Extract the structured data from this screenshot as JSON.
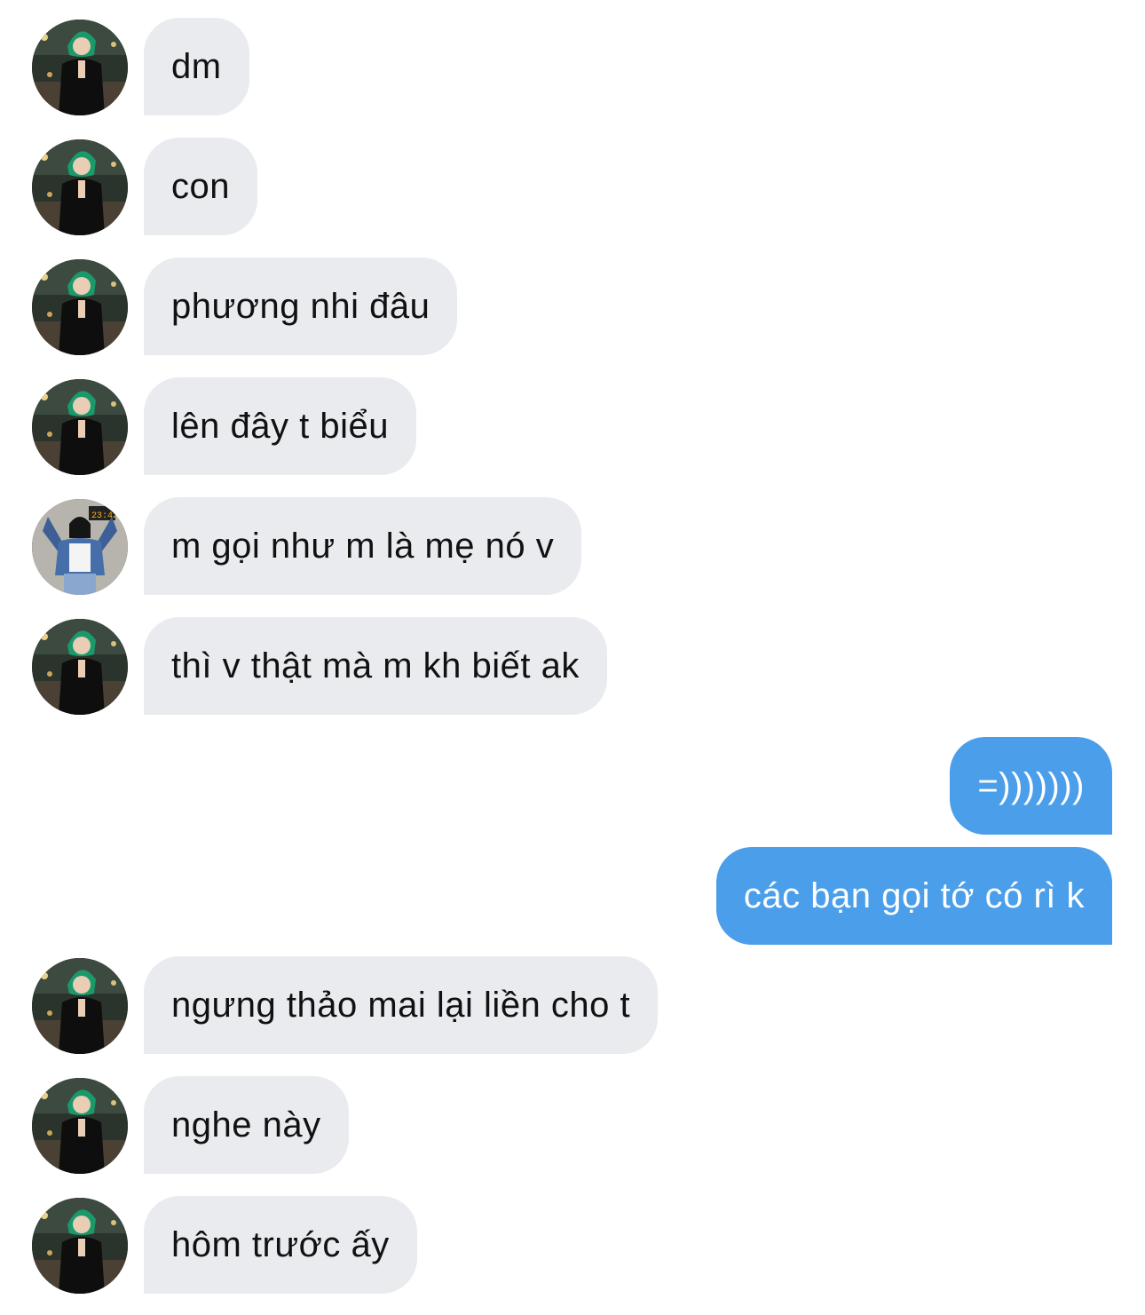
{
  "messages": [
    {
      "text": "dm",
      "sender": "other",
      "avatar": "avatar-a"
    },
    {
      "text": "con",
      "sender": "other",
      "avatar": "avatar-a"
    },
    {
      "text": "phương nhi đâu",
      "sender": "other",
      "avatar": "avatar-a"
    },
    {
      "text": "lên đây t biểu",
      "sender": "other",
      "avatar": "avatar-a"
    },
    {
      "text": "m gọi như m là mẹ nó v",
      "sender": "other",
      "avatar": "avatar-b"
    },
    {
      "text": "thì v thật mà m kh biết ak",
      "sender": "other",
      "avatar": "avatar-a"
    },
    {
      "text": "=)))))))",
      "sender": "me"
    },
    {
      "text": "các bạn gọi tớ có rì k",
      "sender": "me"
    },
    {
      "text": "ngưng thảo mai lại liền cho t",
      "sender": "other",
      "avatar": "avatar-a"
    },
    {
      "text": "nghe này",
      "sender": "other",
      "avatar": "avatar-a"
    },
    {
      "text": "hôm trước ấy",
      "sender": "other",
      "avatar": "avatar-a"
    }
  ],
  "colors": {
    "incoming_bubble": "#e9ebef",
    "outgoing_bubble": "#4a9eea",
    "incoming_text": "#111111",
    "outgoing_text": "#ffffff"
  }
}
